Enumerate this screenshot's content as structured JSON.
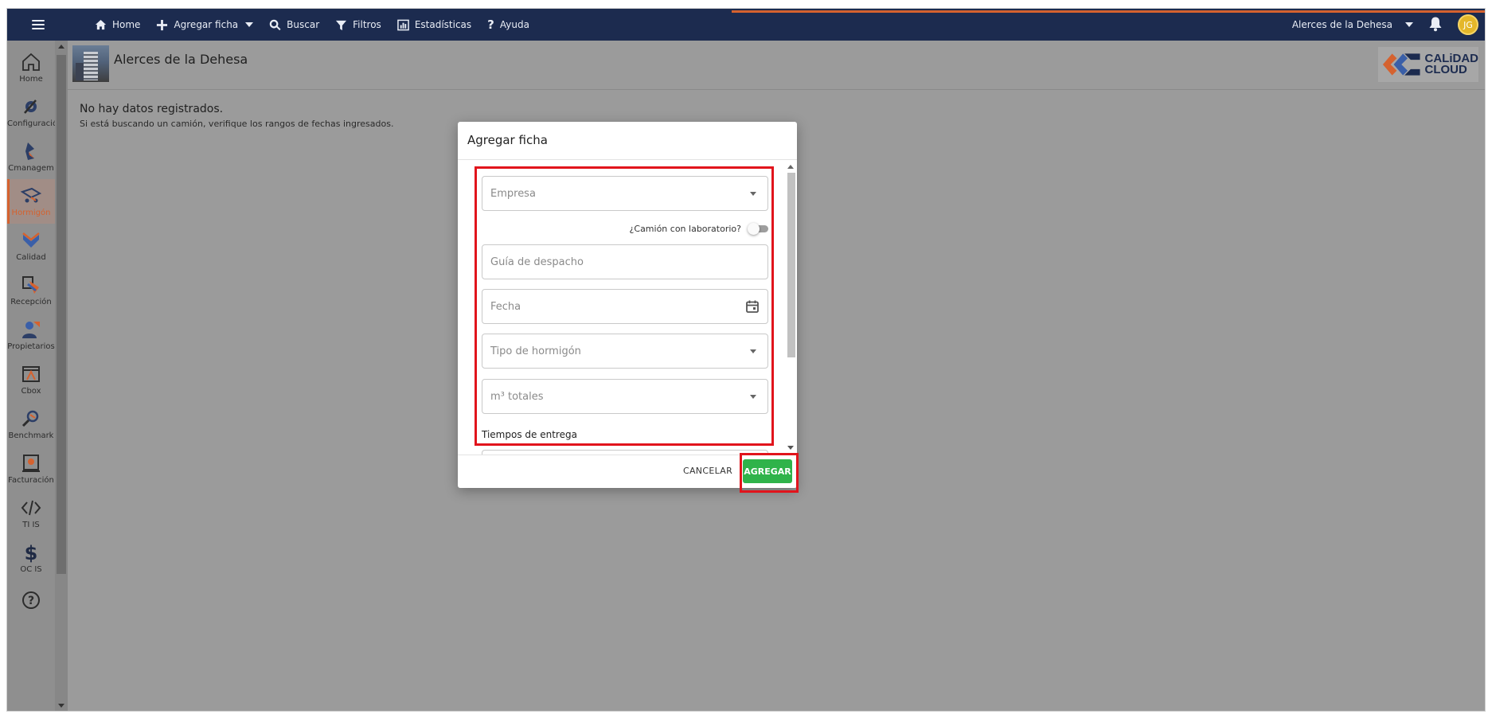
{
  "topbar": {
    "nav": [
      {
        "label": "Home",
        "icon": "home-icon"
      },
      {
        "label": "Agregar ficha",
        "icon": "plus-icon"
      },
      {
        "label": "Buscar",
        "icon": "search-icon"
      },
      {
        "label": "Filtros",
        "icon": "filter-icon"
      },
      {
        "label": "Estadísticas",
        "icon": "stats-icon"
      },
      {
        "label": "Ayuda",
        "icon": "help-icon"
      }
    ],
    "project_selector": "Alerces de la Dehesa",
    "avatar_initials": "JG"
  },
  "sidebar": {
    "items": [
      {
        "label": "Home",
        "icon": "home-icon"
      },
      {
        "label": "Configuració",
        "icon": "settings-icon"
      },
      {
        "label": "Cmanagem",
        "icon": "cmanagement-icon"
      },
      {
        "label": "Hormigón",
        "icon": "concrete-truck-icon",
        "active": true
      },
      {
        "label": "Calidad",
        "icon": "quality-icon"
      },
      {
        "label": "Recepción",
        "icon": "reception-icon"
      },
      {
        "label": "Propietarios",
        "icon": "owners-icon"
      },
      {
        "label": "Cbox",
        "icon": "cbox-icon"
      },
      {
        "label": "Benchmark",
        "icon": "benchmark-icon"
      },
      {
        "label": "Facturación",
        "icon": "billing-icon"
      },
      {
        "label": "TI IS",
        "icon": "code-icon"
      },
      {
        "label": "OC IS",
        "icon": "dollar-icon"
      },
      {
        "label": "",
        "icon": "help-circle-icon"
      }
    ]
  },
  "header": {
    "project_title": "Alerces de la Dehesa",
    "logo_line1": "CALiDAD",
    "logo_line2": "CLOUD"
  },
  "main": {
    "empty_title": "No hay datos registrados.",
    "empty_subtitle": "Si está buscando un camión, verifique los rangos de fechas ingresados."
  },
  "modal": {
    "title": "Agregar ficha",
    "empresa_placeholder": "Empresa",
    "lab_toggle_label": "¿Camión con laboratorio?",
    "lab_toggle_value": false,
    "guia_placeholder": "Guía de despacho",
    "fecha_placeholder": "Fecha",
    "tipo_placeholder": "Tipo de hormigón",
    "m3_placeholder": "m³ totales",
    "tiempos_label": "Tiempos de entrega",
    "cancel_label": "CANCELAR",
    "add_label": "AGREGAR"
  },
  "colors": {
    "topbar": "#1c2b4f",
    "accent": "#d5622f",
    "add_button": "#2fb34a",
    "highlight": "#e1141c"
  }
}
